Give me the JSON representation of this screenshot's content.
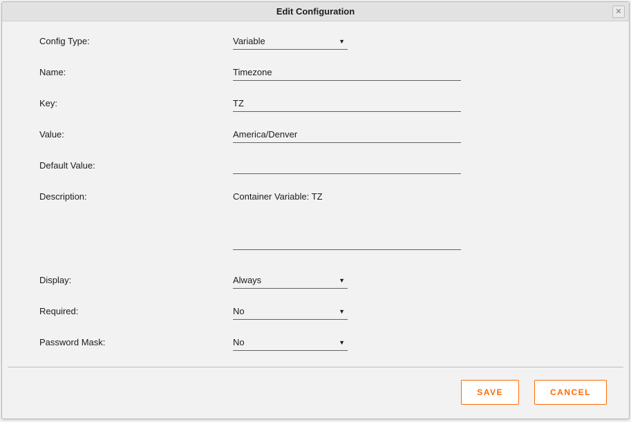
{
  "dialog": {
    "title": "Edit Configuration"
  },
  "fields": {
    "config_type": {
      "label": "Config Type:",
      "value": "Variable"
    },
    "name": {
      "label": "Name:",
      "value": "Timezone"
    },
    "key": {
      "label": "Key:",
      "value": "TZ"
    },
    "value": {
      "label": "Value:",
      "value": "America/Denver"
    },
    "default": {
      "label": "Default Value:",
      "value": ""
    },
    "description": {
      "label": "Description:",
      "value": "Container Variable: TZ"
    },
    "display": {
      "label": "Display:",
      "value": "Always"
    },
    "required": {
      "label": "Required:",
      "value": "No"
    },
    "pwmask": {
      "label": "Password Mask:",
      "value": "No"
    }
  },
  "buttons": {
    "save": "SAVE",
    "cancel": "CANCEL"
  }
}
